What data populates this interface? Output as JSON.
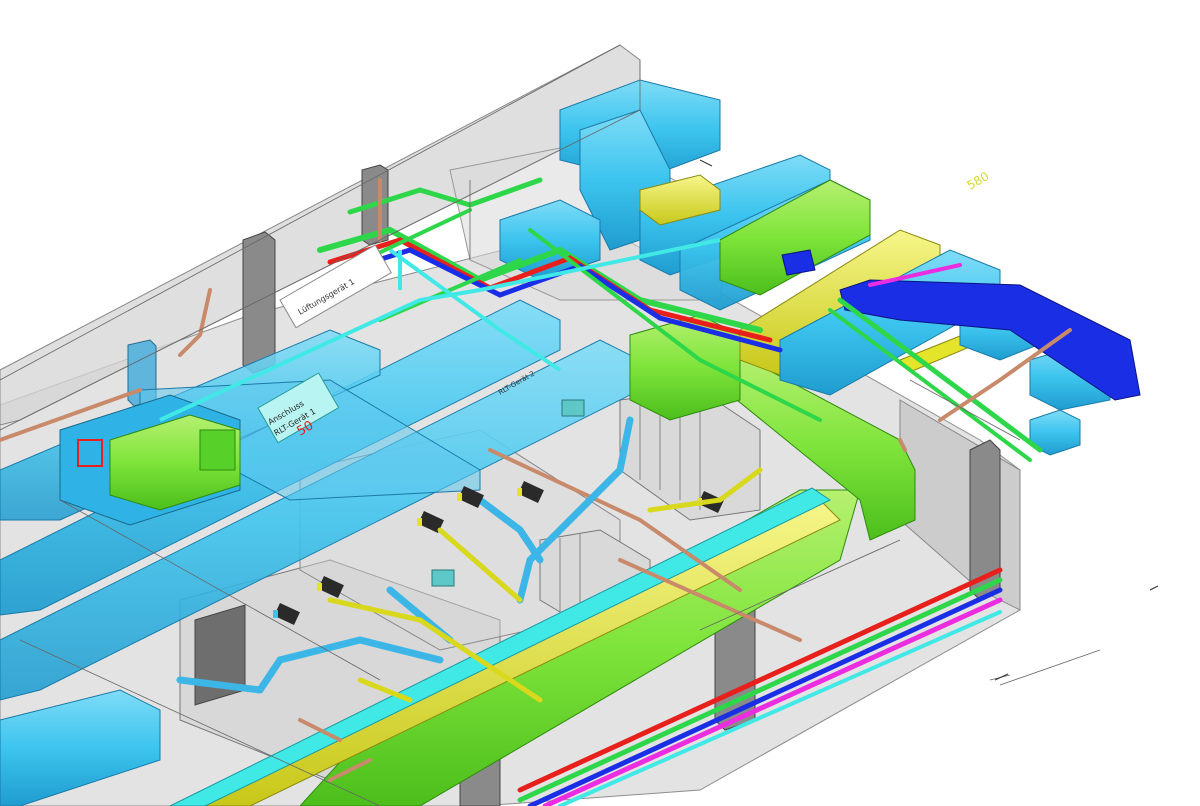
{
  "labels": {
    "label_580": "580",
    "label_50": "50",
    "label_lueftungsgeraet_1": "Lüftungsgerät 1",
    "label_rlt_geraet_1": "RLT-Gerät 1",
    "label_anschluss": "Anschluss",
    "label_rlt_geraet_2": "RLT-Gerät 2"
  },
  "colors": {
    "supply_air_duct": "#3cc4ee",
    "exhaust_duct": "#7ee43a",
    "outside_air_duct": "#1a2ee6",
    "yellow_duct": "#e4e42a",
    "heating_supply": "#e8201c",
    "heating_return": "#2ed64a",
    "chilled_water": "#1a2ee6",
    "drain": "#ec2ce0",
    "copper_pipe": "#c88a6a",
    "cyan_pipe": "#40e8e6",
    "wall": "#c6c6c6",
    "column": "#8a8a8a"
  }
}
